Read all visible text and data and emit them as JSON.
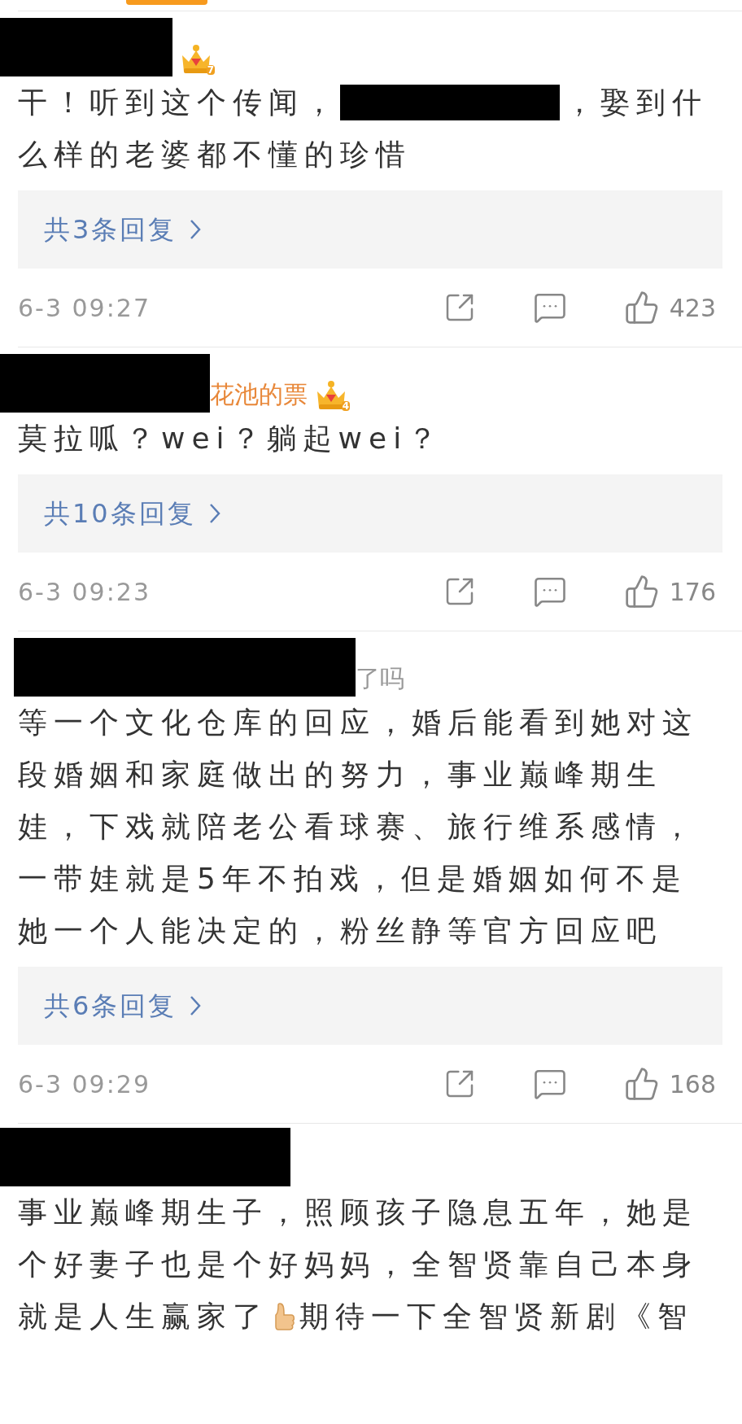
{
  "comments": [
    {
      "crown_level": "7",
      "lines": [
        [
          {
            "kind": "text",
            "value": "干！听到这个传闻，"
          },
          {
            "kind": "redacted"
          },
          {
            "kind": "text",
            "value": "，娶到什"
          }
        ],
        [
          {
            "kind": "text",
            "value": "么样的老婆都不懂的珍惜"
          }
        ]
      ],
      "replies": "共3条回复",
      "time": "6-3 09:27",
      "likes": "423"
    },
    {
      "name_tail": "花池的票",
      "crown_level": "4",
      "text": "莫拉呱？wei？躺起wei？",
      "replies": "共10条回复",
      "time": "6-3 09:23",
      "likes": "176"
    },
    {
      "name_tail": "了吗",
      "text": "等一个文化仓库的回应，婚后能看到她对这段婚姻和家庭做出的努力，事业巅峰期生娃，下戏就陪老公看球赛、旅行维系感情，一带娃就是5年不拍戏，但是婚姻如何不是她一个人能决定的，粉丝静等官方回应吧",
      "replies": "共6条回复",
      "time": "6-3 09:29",
      "likes": "168"
    },
    {
      "lines": [
        [
          {
            "kind": "text",
            "value": "事业巅峰期生子，照顾孩子隐息五年，她是"
          }
        ],
        [
          {
            "kind": "text",
            "value": "个好妻子也是个好妈妈，全智贤靠自己本身"
          }
        ],
        [
          {
            "kind": "text",
            "value": "就是人生赢家了"
          },
          {
            "kind": "thumb"
          },
          {
            "kind": "text",
            "value": "期待一下全智贤新剧《智"
          }
        ]
      ]
    }
  ]
}
